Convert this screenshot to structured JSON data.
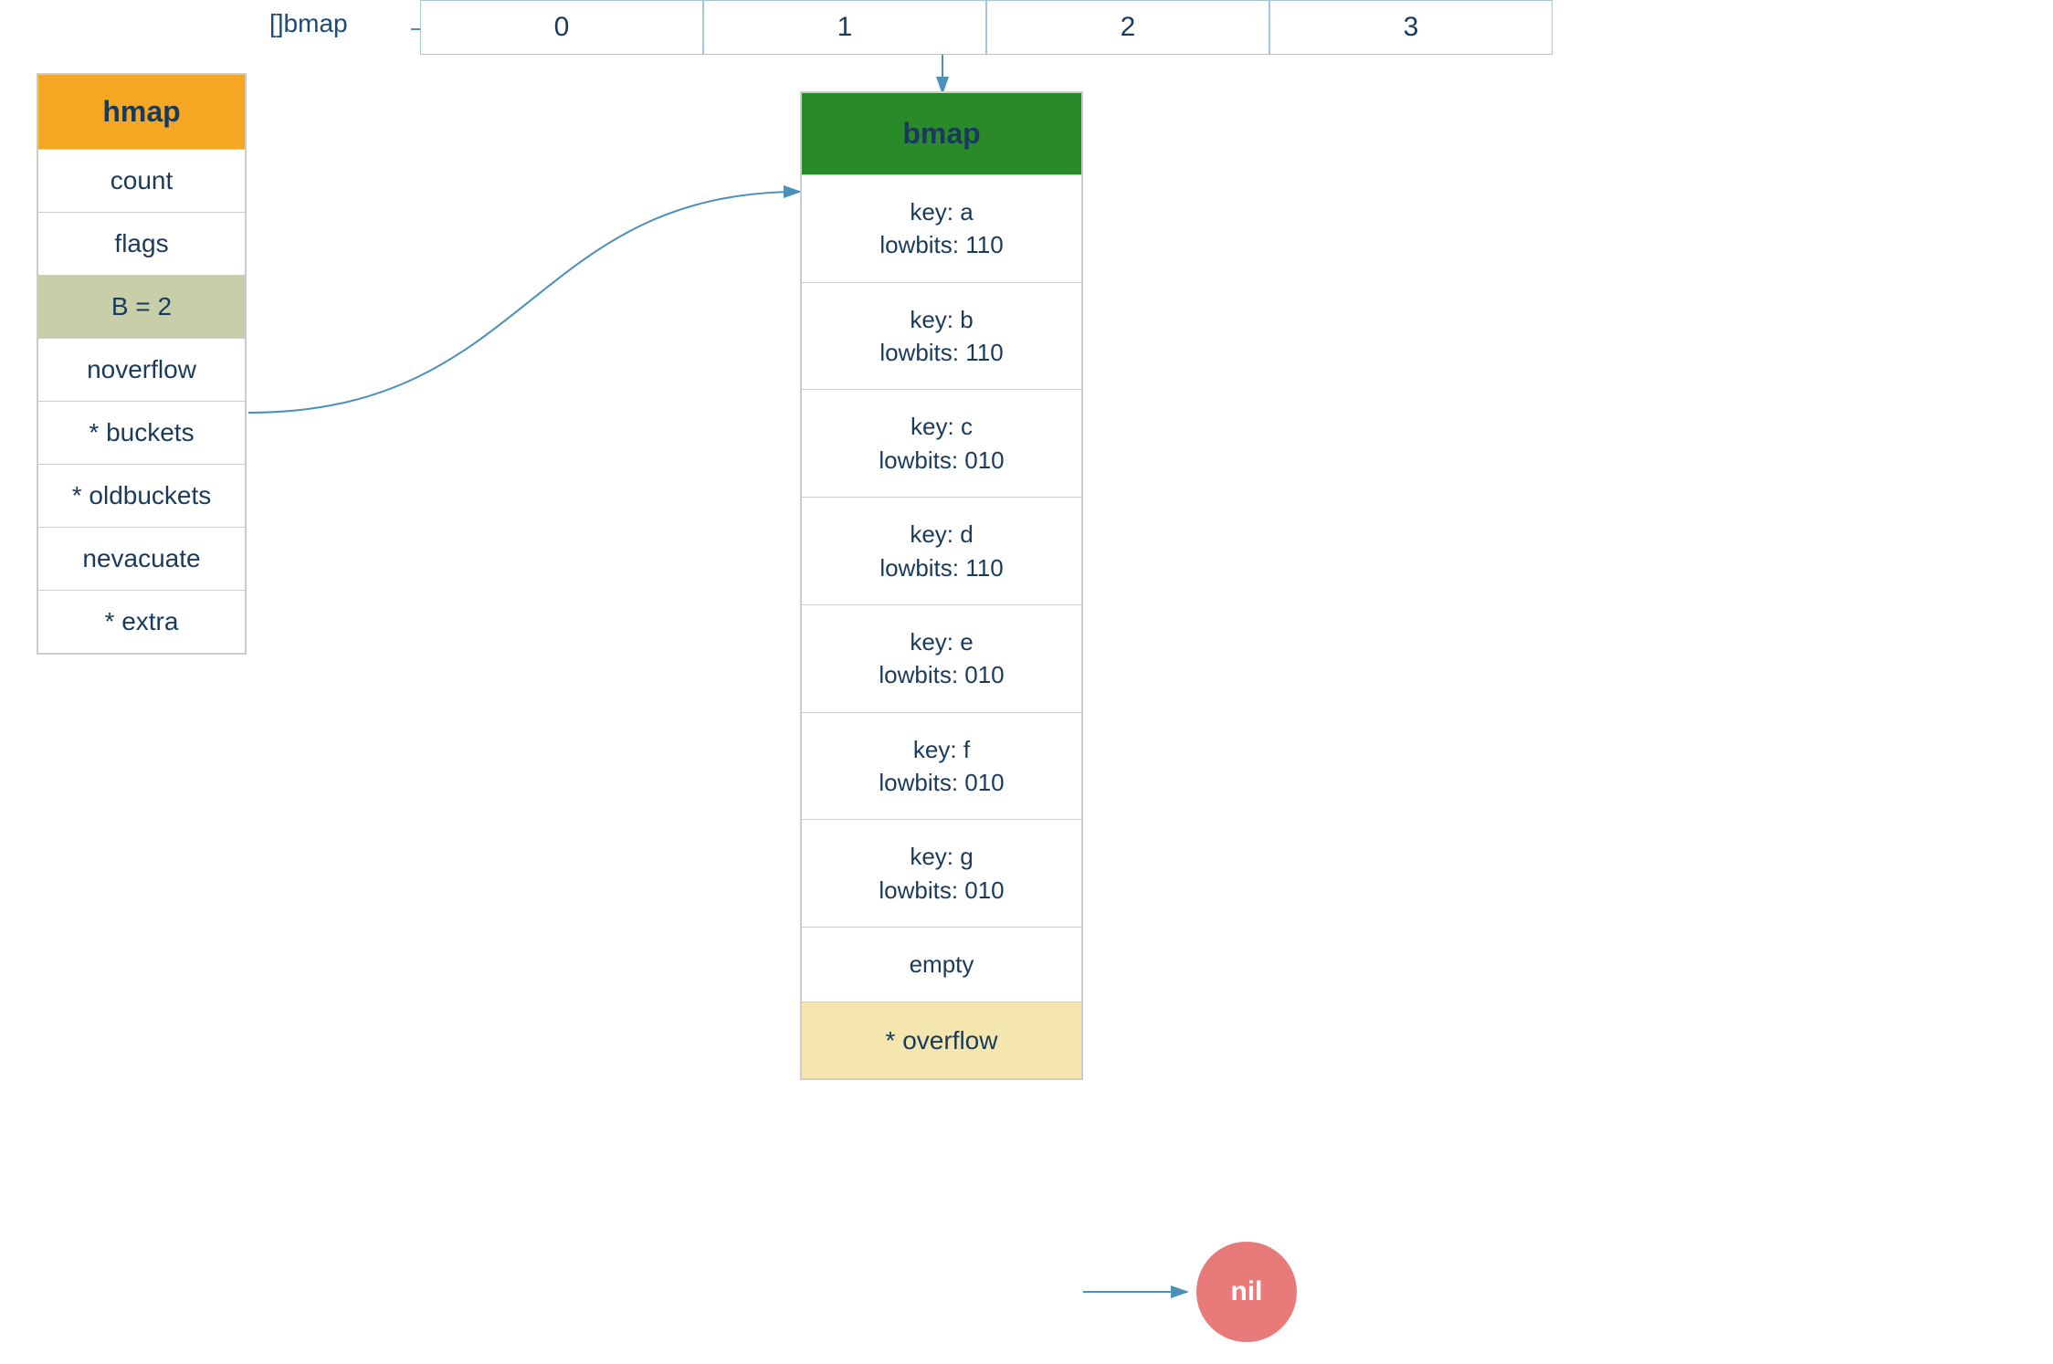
{
  "hmap": {
    "title": "hmap",
    "fields": [
      {
        "label": "count",
        "highlight": false
      },
      {
        "label": "flags",
        "highlight": false
      },
      {
        "label": "B = 2",
        "highlight": true
      },
      {
        "label": "noverflow",
        "highlight": false
      },
      {
        "label": "* buckets",
        "highlight": false
      },
      {
        "label": "* oldbuckets",
        "highlight": false
      },
      {
        "label": "nevacuate",
        "highlight": false
      },
      {
        "label": "* extra",
        "highlight": false
      }
    ]
  },
  "array": {
    "label": "[]bmap",
    "indices": [
      "0",
      "1",
      "2",
      "3"
    ]
  },
  "bmap": {
    "title": "bmap",
    "entries": [
      {
        "key": "a",
        "lowbits": "110"
      },
      {
        "key": "b",
        "lowbits": "110"
      },
      {
        "key": "c",
        "lowbits": "010"
      },
      {
        "key": "d",
        "lowbits": "110"
      },
      {
        "key": "e",
        "lowbits": "010"
      },
      {
        "key": "f",
        "lowbits": "010"
      },
      {
        "key": "g",
        "lowbits": "010"
      }
    ],
    "empty_label": "empty",
    "overflow_label": "* overflow"
  },
  "nil_label": "nil",
  "colors": {
    "hmap_title_bg": "#f5a623",
    "bmap_title_bg": "#2a8a2a",
    "overflow_bg": "#f5e6b0",
    "highlight_bg": "#c8cfa8",
    "arrow_color": "#4a90b8",
    "nil_bg": "#e87a7a",
    "text_dark": "#1a3a5c"
  }
}
